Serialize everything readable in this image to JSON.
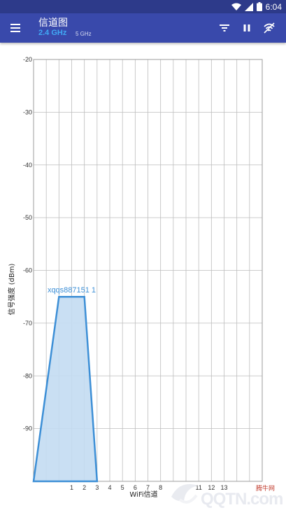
{
  "status_bar": {
    "time": "6:04",
    "icons": [
      "wifi-icon",
      "signal-icon",
      "battery-icon"
    ]
  },
  "app_bar": {
    "title": "信道图",
    "band_selected": "2.4 GHz",
    "band_other": "5 GHz",
    "actions": [
      "filter-icon",
      "pause-icon",
      "wifi-scan-icon"
    ],
    "menu_icon": "menu-icon"
  },
  "colors": {
    "status_bar": "#2d3a8a",
    "app_bar": "#3949ab",
    "accent": "#40a9f5",
    "series": "#3d8fd6",
    "series_fill": "#c3dcf2",
    "grid": "#bdbdbd"
  },
  "chart_data": {
    "type": "area",
    "xlabel": "WiFi信道",
    "ylabel": "信号强度 (dBm)",
    "x_ticks": [
      1,
      2,
      3,
      4,
      5,
      6,
      7,
      8,
      11,
      12,
      13
    ],
    "y_ticks": [
      -20,
      -30,
      -40,
      -50,
      -60,
      -70,
      -80,
      -90
    ],
    "xlim": [
      -2,
      16
    ],
    "ylim": [
      -100,
      -20
    ],
    "grid": true,
    "series": [
      {
        "name": "xqqs887151 1",
        "points": [
          [
            -2,
            -100
          ],
          [
            0,
            -65
          ],
          [
            2,
            -65
          ],
          [
            3,
            -100
          ]
        ]
      }
    ]
  },
  "watermark": {
    "text": "QQTN.com",
    "small_text": "腾牛网"
  }
}
